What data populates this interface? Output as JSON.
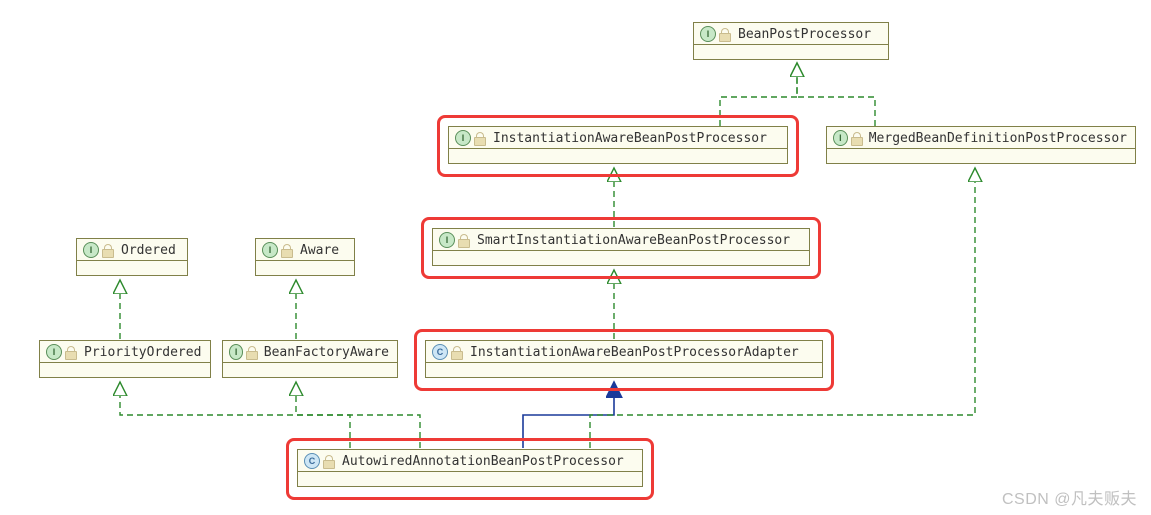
{
  "nodes": {
    "bpp": {
      "name": "BeanPostProcessor",
      "kind": "I"
    },
    "iabpp": {
      "name": "InstantiationAwareBeanPostProcessor",
      "kind": "I"
    },
    "mbdpp": {
      "name": "MergedBeanDefinitionPostProcessor",
      "kind": "I"
    },
    "ordered": {
      "name": "Ordered",
      "kind": "I"
    },
    "aware": {
      "name": "Aware",
      "kind": "I"
    },
    "siabpp": {
      "name": "SmartInstantiationAwareBeanPostProcessor",
      "kind": "I"
    },
    "pordered": {
      "name": "PriorityOrdered",
      "kind": "I"
    },
    "bfaware": {
      "name": "BeanFactoryAware",
      "kind": "I"
    },
    "iabppa": {
      "name": "InstantiationAwareBeanPostProcessorAdapter",
      "kind": "C"
    },
    "aabpp": {
      "name": "AutowiredAnnotationBeanPostProcessor",
      "kind": "C"
    }
  },
  "highlighted": [
    "iabpp",
    "siabpp",
    "iabppa",
    "aabpp"
  ],
  "edges": [
    {
      "from": "iabpp",
      "to": "bpp",
      "style": "dashed"
    },
    {
      "from": "mbdpp",
      "to": "bpp",
      "style": "dashed"
    },
    {
      "from": "siabpp",
      "to": "iabpp",
      "style": "dashed"
    },
    {
      "from": "pordered",
      "to": "ordered",
      "style": "dashed"
    },
    {
      "from": "bfaware",
      "to": "aware",
      "style": "dashed"
    },
    {
      "from": "iabppa",
      "to": "siabpp",
      "style": "dashed"
    },
    {
      "from": "aabpp",
      "to": "iabppa",
      "style": "solid-blue"
    },
    {
      "from": "aabpp",
      "to": "pordered",
      "style": "dashed"
    },
    {
      "from": "aabpp",
      "to": "bfaware",
      "style": "dashed"
    },
    {
      "from": "aabpp",
      "to": "mbdpp",
      "style": "dashed"
    }
  ],
  "watermark": "CSDN @凡夫贩夫",
  "chart_data": {
    "type": "uml-class-hierarchy",
    "description": "UML interface/class hierarchy for Spring BeanPostProcessor family, with path to AutowiredAnnotationBeanPostProcessor highlighted",
    "entities": [
      {
        "name": "BeanPostProcessor",
        "stereotype": "interface"
      },
      {
        "name": "InstantiationAwareBeanPostProcessor",
        "stereotype": "interface",
        "highlighted": true
      },
      {
        "name": "MergedBeanDefinitionPostProcessor",
        "stereotype": "interface"
      },
      {
        "name": "Ordered",
        "stereotype": "interface"
      },
      {
        "name": "Aware",
        "stereotype": "interface"
      },
      {
        "name": "SmartInstantiationAwareBeanPostProcessor",
        "stereotype": "interface",
        "highlighted": true
      },
      {
        "name": "PriorityOrdered",
        "stereotype": "interface"
      },
      {
        "name": "BeanFactoryAware",
        "stereotype": "interface"
      },
      {
        "name": "InstantiationAwareBeanPostProcessorAdapter",
        "stereotype": "class",
        "highlighted": true
      },
      {
        "name": "AutowiredAnnotationBeanPostProcessor",
        "stereotype": "class",
        "highlighted": true
      }
    ],
    "relationships": [
      {
        "child": "InstantiationAwareBeanPostProcessor",
        "parent": "BeanPostProcessor",
        "type": "extends (interface)"
      },
      {
        "child": "MergedBeanDefinitionPostProcessor",
        "parent": "BeanPostProcessor",
        "type": "extends (interface)"
      },
      {
        "child": "SmartInstantiationAwareBeanPostProcessor",
        "parent": "InstantiationAwareBeanPostProcessor",
        "type": "extends (interface)"
      },
      {
        "child": "PriorityOrdered",
        "parent": "Ordered",
        "type": "extends (interface)"
      },
      {
        "child": "BeanFactoryAware",
        "parent": "Aware",
        "type": "extends (interface)"
      },
      {
        "child": "InstantiationAwareBeanPostProcessorAdapter",
        "parent": "SmartInstantiationAwareBeanPostProcessor",
        "type": "implements"
      },
      {
        "child": "AutowiredAnnotationBeanPostProcessor",
        "parent": "InstantiationAwareBeanPostProcessorAdapter",
        "type": "extends (class)"
      },
      {
        "child": "AutowiredAnnotationBeanPostProcessor",
        "parent": "PriorityOrdered",
        "type": "implements"
      },
      {
        "child": "AutowiredAnnotationBeanPostProcessor",
        "parent": "BeanFactoryAware",
        "type": "implements"
      },
      {
        "child": "AutowiredAnnotationBeanPostProcessor",
        "parent": "MergedBeanDefinitionPostProcessor",
        "type": "implements"
      }
    ]
  }
}
